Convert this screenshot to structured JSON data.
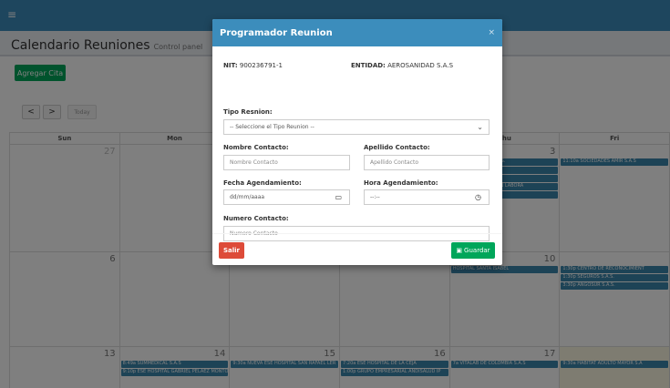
{
  "topbar": {
    "menu_icon": "hamburger-icon",
    "menu_glyph": "≡"
  },
  "header": {
    "title": "Calendario Reuniones",
    "subtitle": "Control panel"
  },
  "toolbar": {
    "add_label": "Agregar Cita"
  },
  "calendar_nav": {
    "prev": "<",
    "next": ">",
    "today": "Today"
  },
  "calendar": {
    "weekdays": [
      "Sun",
      "Mon",
      "Tue",
      "Wed",
      "Thu",
      "Fri"
    ],
    "rows": [
      {
        "days": [
          {
            "num": "27",
            "faded": true,
            "events": []
          },
          {
            "num": "",
            "events": []
          },
          {
            "num": "",
            "events": []
          },
          {
            "num": "",
            "events": []
          },
          {
            "num": "3",
            "events": [
              "FORMALIZACIÓN S.A.S.",
              "SALUD S.A.S",
              "NAR S.A.S",
              "SALUD Y PREVENCION LABORA",
              "CONSENSO S.A.S"
            ]
          },
          {
            "num": "",
            "events": [
              "11:10a SOCIEDADES AMIR S.A.S"
            ]
          }
        ]
      },
      {
        "days": [
          {
            "num": "6",
            "events": []
          },
          {
            "num": "",
            "events": []
          },
          {
            "num": "",
            "events": []
          },
          {
            "num": "",
            "events": []
          },
          {
            "num": "10",
            "events": [
              "HOSPITAL SANTA ISABEL"
            ]
          },
          {
            "num": "",
            "events": [
              "1:30p CENTRO DE RECONOCIMIENT",
              "1:30p SEGUROS S.A.S.",
              "3:30p ANGOSUR S.A.S."
            ]
          }
        ]
      },
      {
        "days": [
          {
            "num": "13",
            "events": []
          },
          {
            "num": "14",
            "events": [
              "8:49a SUMMEDICAL S.A.S",
              "9:10p ESE HOSPITAL GABRIEL PELAEZ MONTO"
            ]
          },
          {
            "num": "15",
            "events": [
              "9:30a NUEVA ESE HOSPITAL SAN RAFAEL LER"
            ]
          },
          {
            "num": "16",
            "events": [
              "7:20a ESE HOSPITAL DE LA CEJA",
              "1:00p GRUPO EMPRESARIAL ANDISALUD IP"
            ]
          },
          {
            "num": "17",
            "events": [
              "7a VITALAB DE COLOMBIA S.A.S"
            ]
          },
          {
            "num": "",
            "today": true,
            "events": [
              "9:30a HABITAT ADULTO MAYOR S.A"
            ]
          }
        ]
      }
    ]
  },
  "modal": {
    "title": "Programador Reunion",
    "close": "×",
    "nit_label": "NIT:",
    "nit_value": "900236791-1",
    "entity_label": "ENTIDAD:",
    "entity_value": "AEROSANIDAD S.A.S",
    "tipo_label": "Tipo Resnion:",
    "tipo_selected": "-- Seleccione el Tipo Reunion --",
    "nombre_label": "Nombre Contacto:",
    "nombre_placeholder": "Nombre Contacto",
    "apellido_label": "Apellido Contacto:",
    "apellido_placeholder": "Apellido Contacto",
    "fecha_label": "Fecha Agendamiento:",
    "fecha_value": "dd/mm/aaaa",
    "hora_label": "Hora Agendamiento:",
    "hora_value": "--:--",
    "numero_label": "Numero Contacto:",
    "numero_placeholder": "Numero Contacto",
    "exit_label": "Salir",
    "save_label": "Guardar"
  },
  "colors": {
    "primary": "#3c8dbc",
    "success": "#00a65a",
    "danger": "#dd4b39",
    "event": "#3a87ad"
  }
}
